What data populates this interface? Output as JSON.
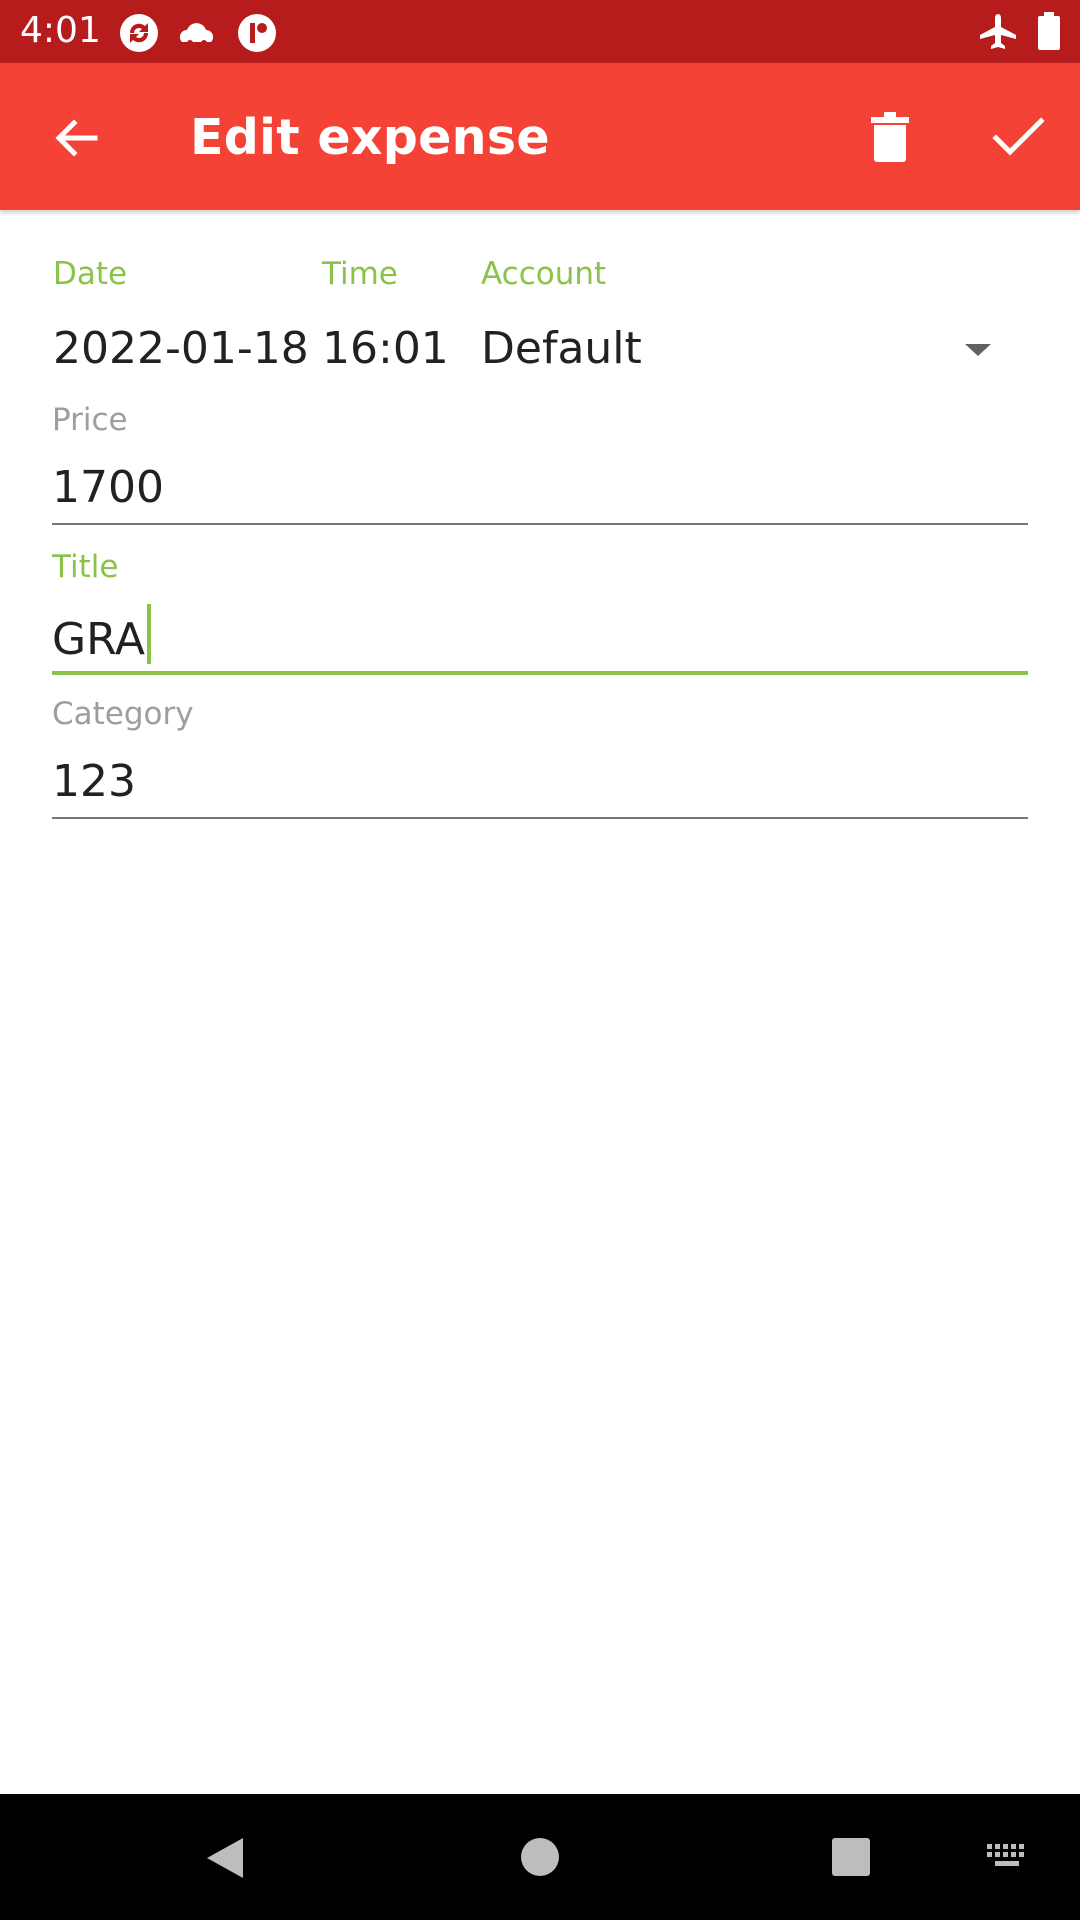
{
  "status_bar": {
    "time": "4:01",
    "icons": [
      "sync-icon",
      "cloud-icon",
      "notification-app-icon"
    ],
    "right_icons": [
      "airplane-mode-icon",
      "battery-icon"
    ]
  },
  "app_bar": {
    "title": "Edit expense",
    "back_icon": "arrow-back-icon",
    "delete_icon": "trash-icon",
    "confirm_icon": "check-icon",
    "color": "#f44336"
  },
  "form": {
    "date": {
      "label": "Date",
      "value": "2022-01-18"
    },
    "time": {
      "label": "Time",
      "value": "16:01"
    },
    "account": {
      "label": "Account",
      "value": "Default"
    },
    "price": {
      "label": "Price",
      "value": "1700"
    },
    "title": {
      "label": "Title",
      "value": "GRA"
    },
    "category": {
      "label": "Category",
      "value": "123"
    },
    "accent_color": "#8bc34a"
  },
  "nav_bar": {
    "buttons": [
      "back-nav-icon",
      "home-nav-icon",
      "recents-nav-icon",
      "keyboard-icon"
    ]
  }
}
